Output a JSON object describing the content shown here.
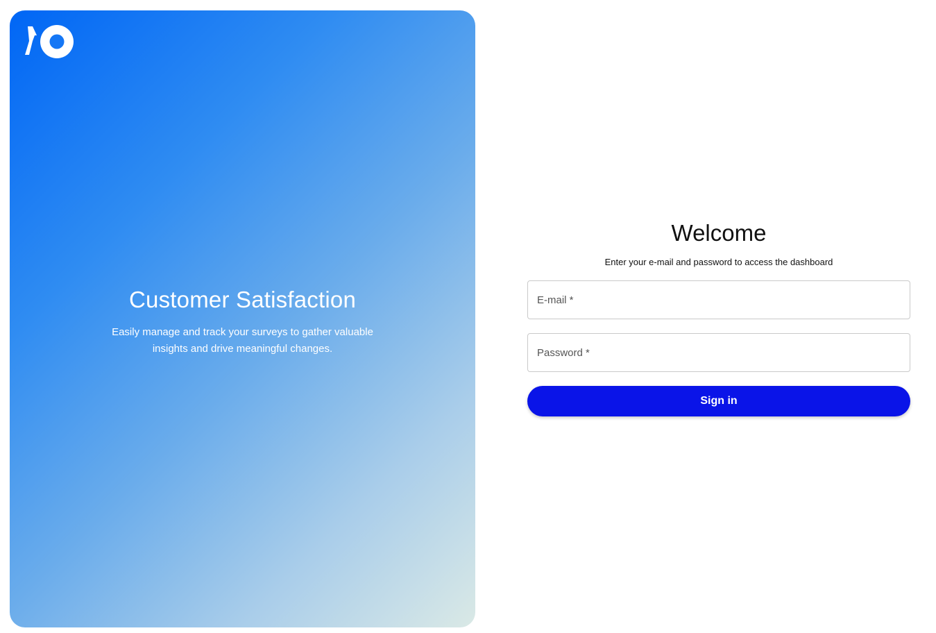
{
  "hero": {
    "title": "Customer Satisfaction",
    "subtitle": "Easily manage and track your surveys to gather valuable insights and drive meaningful changes.",
    "gradient_start": "#0066f5",
    "gradient_end": "#dae9e6",
    "logo_icon": "brand-logo-icon"
  },
  "login": {
    "title": "Welcome",
    "subtitle": "Enter your e-mail and password to access the dashboard",
    "email_placeholder": "E-mail *",
    "password_placeholder": "Password *",
    "signin_label": "Sign in",
    "button_color": "#0a14e8"
  }
}
